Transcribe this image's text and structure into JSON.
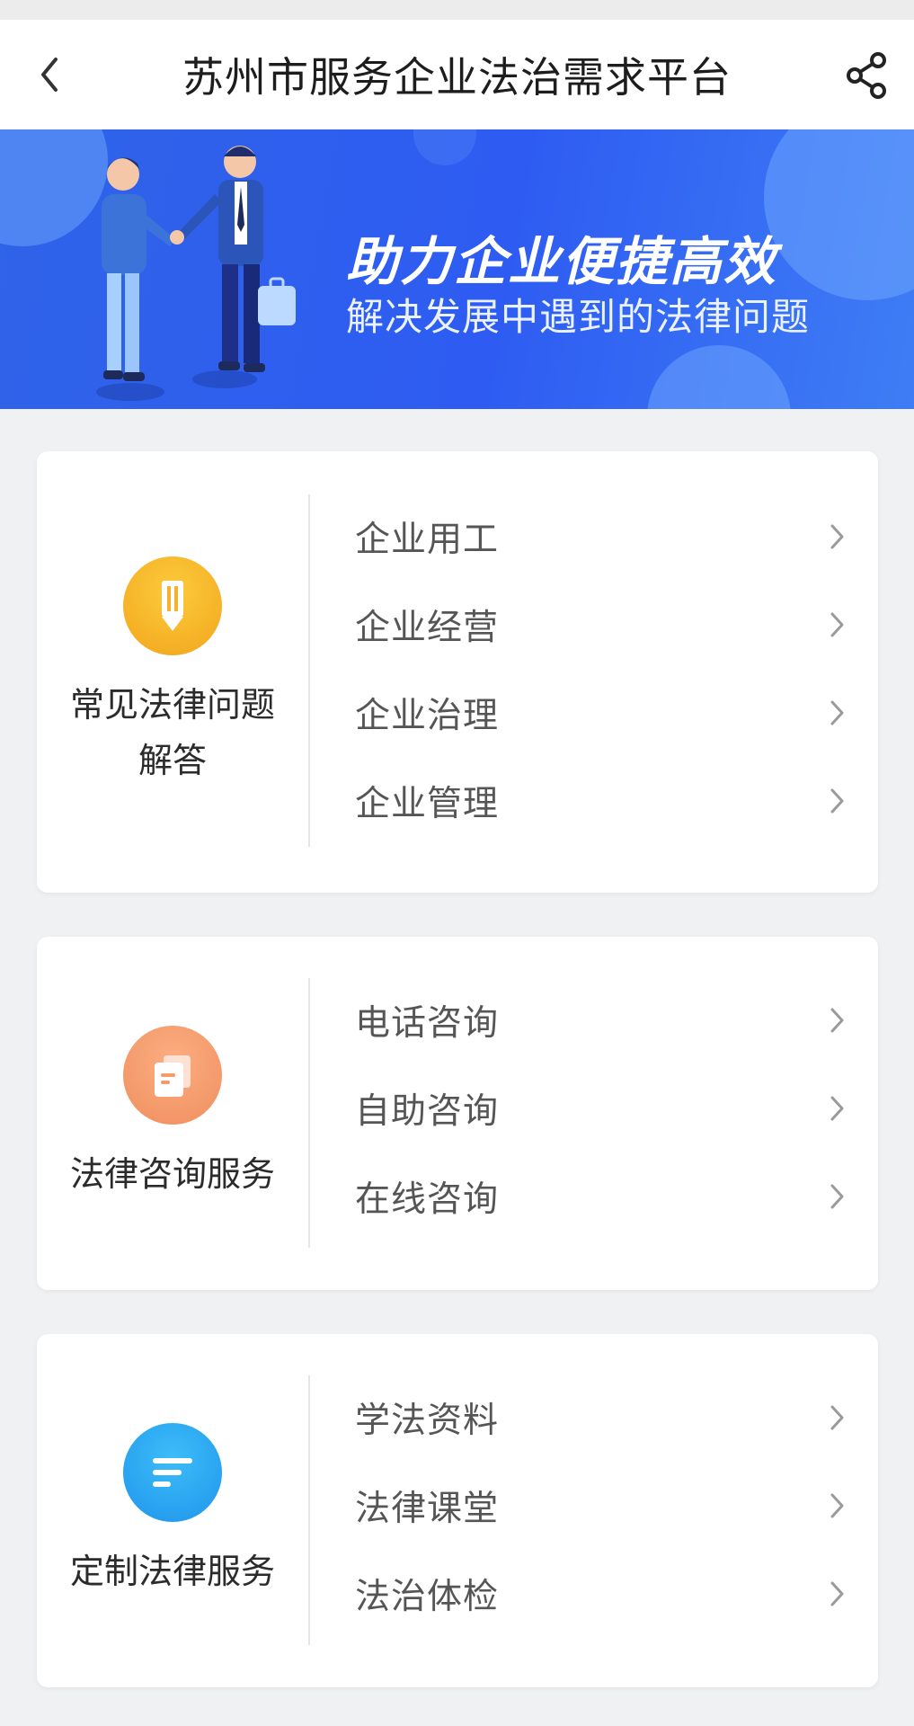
{
  "header": {
    "title": "苏州市服务企业法治需求平台",
    "back_icon": "chevron-left-icon",
    "share_icon": "share-icon"
  },
  "banner": {
    "headline": "助力企业便捷高效",
    "subtitle": "解决发展中遇到的法律问题"
  },
  "sections": [
    {
      "name_line1": "常见法律问题",
      "name_line2": "解答",
      "icon": "pencil-icon",
      "icon_color": "#f6b22a",
      "items": [
        {
          "label": "企业用工"
        },
        {
          "label": "企业经营"
        },
        {
          "label": "企业治理"
        },
        {
          "label": "企业管理"
        }
      ]
    },
    {
      "name_line1": "法律咨询服务",
      "icon": "document-icon",
      "icon_color": "#f59a6a",
      "items": [
        {
          "label": "电话咨询"
        },
        {
          "label": "自助咨询"
        },
        {
          "label": "在线咨询"
        }
      ]
    },
    {
      "name_line1": "定制法律服务",
      "icon": "list-icon",
      "icon_color": "#2aa6f2",
      "items": [
        {
          "label": "学法资料"
        },
        {
          "label": "法律课堂"
        },
        {
          "label": "法治体检"
        }
      ]
    }
  ]
}
